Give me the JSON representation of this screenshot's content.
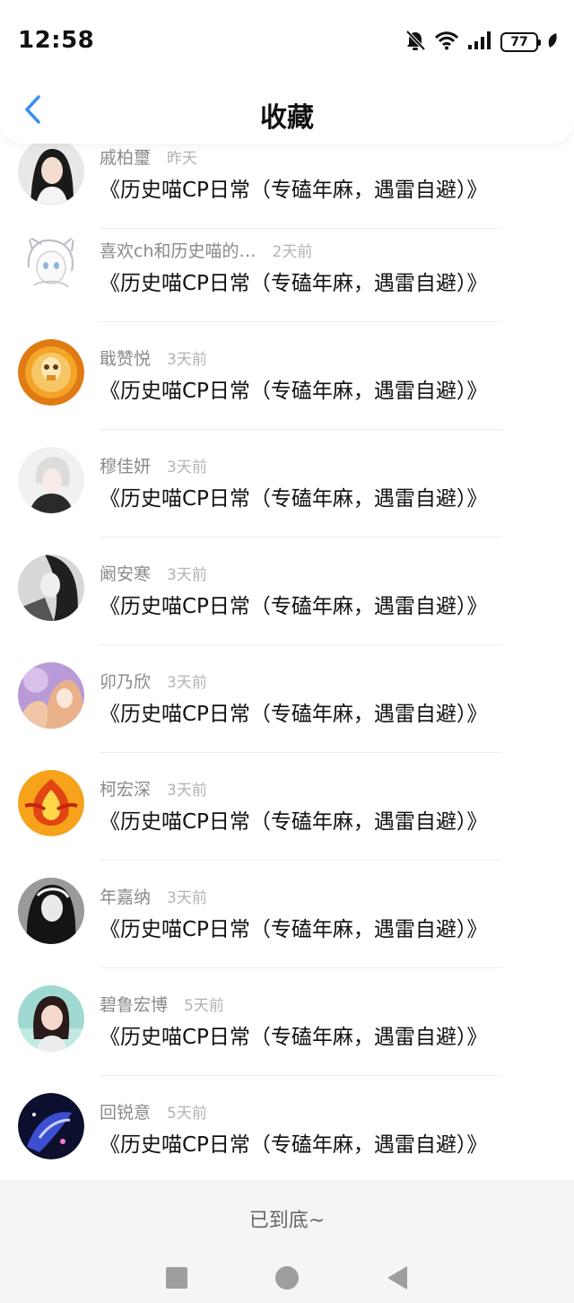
{
  "status_bar": {
    "time": "12:58",
    "battery": "77",
    "icons": [
      "bell-muted-icon",
      "wifi-icon",
      "signal-icon",
      "battery-icon",
      "leaf-icon"
    ]
  },
  "header": {
    "title": "收藏",
    "back_icon": "chevron-left-icon"
  },
  "colors": {
    "accent": "#3b8ef0",
    "text_primary": "#111111",
    "text_secondary": "#8a8a8a",
    "text_muted": "#b3b3b3",
    "footer_bg": "#f6f5f5"
  },
  "items": [
    {
      "author": "戚柏璽",
      "time": "昨天",
      "title": "《历史喵CP日常（专磕年麻，遇雷自避）》"
    },
    {
      "author": "喜欢ch和历史喵的…",
      "time": "2天前",
      "title": "《历史喵CP日常（专磕年麻，遇雷自避）》"
    },
    {
      "author": "戢赞悦",
      "time": "3天前",
      "title": "《历史喵CP日常（专磕年麻，遇雷自避）》"
    },
    {
      "author": "穆佳妍",
      "time": "3天前",
      "title": "《历史喵CP日常（专磕年麻，遇雷自避）》"
    },
    {
      "author": "阚安寒",
      "time": "3天前",
      "title": "《历史喵CP日常（专磕年麻，遇雷自避）》"
    },
    {
      "author": "卯乃欣",
      "time": "3天前",
      "title": "《历史喵CP日常（专磕年麻，遇雷自避）》"
    },
    {
      "author": "柯宏深",
      "time": "3天前",
      "title": "《历史喵CP日常（专磕年麻，遇雷自避）》"
    },
    {
      "author": "年嘉纳",
      "time": "3天前",
      "title": "《历史喵CP日常（专磕年麻，遇雷自避）》"
    },
    {
      "author": "碧鲁宏博",
      "time": "5天前",
      "title": "《历史喵CP日常（专磕年麻，遇雷自避）》"
    },
    {
      "author": "回锐意",
      "time": "5天前",
      "title": "《历史喵CP日常（专磕年麻，遇雷自避）》"
    }
  ],
  "footer": {
    "end_text": "已到底~"
  },
  "nav_bar": {
    "buttons": [
      "recents-square-icon",
      "home-circle-icon",
      "back-triangle-icon"
    ]
  }
}
